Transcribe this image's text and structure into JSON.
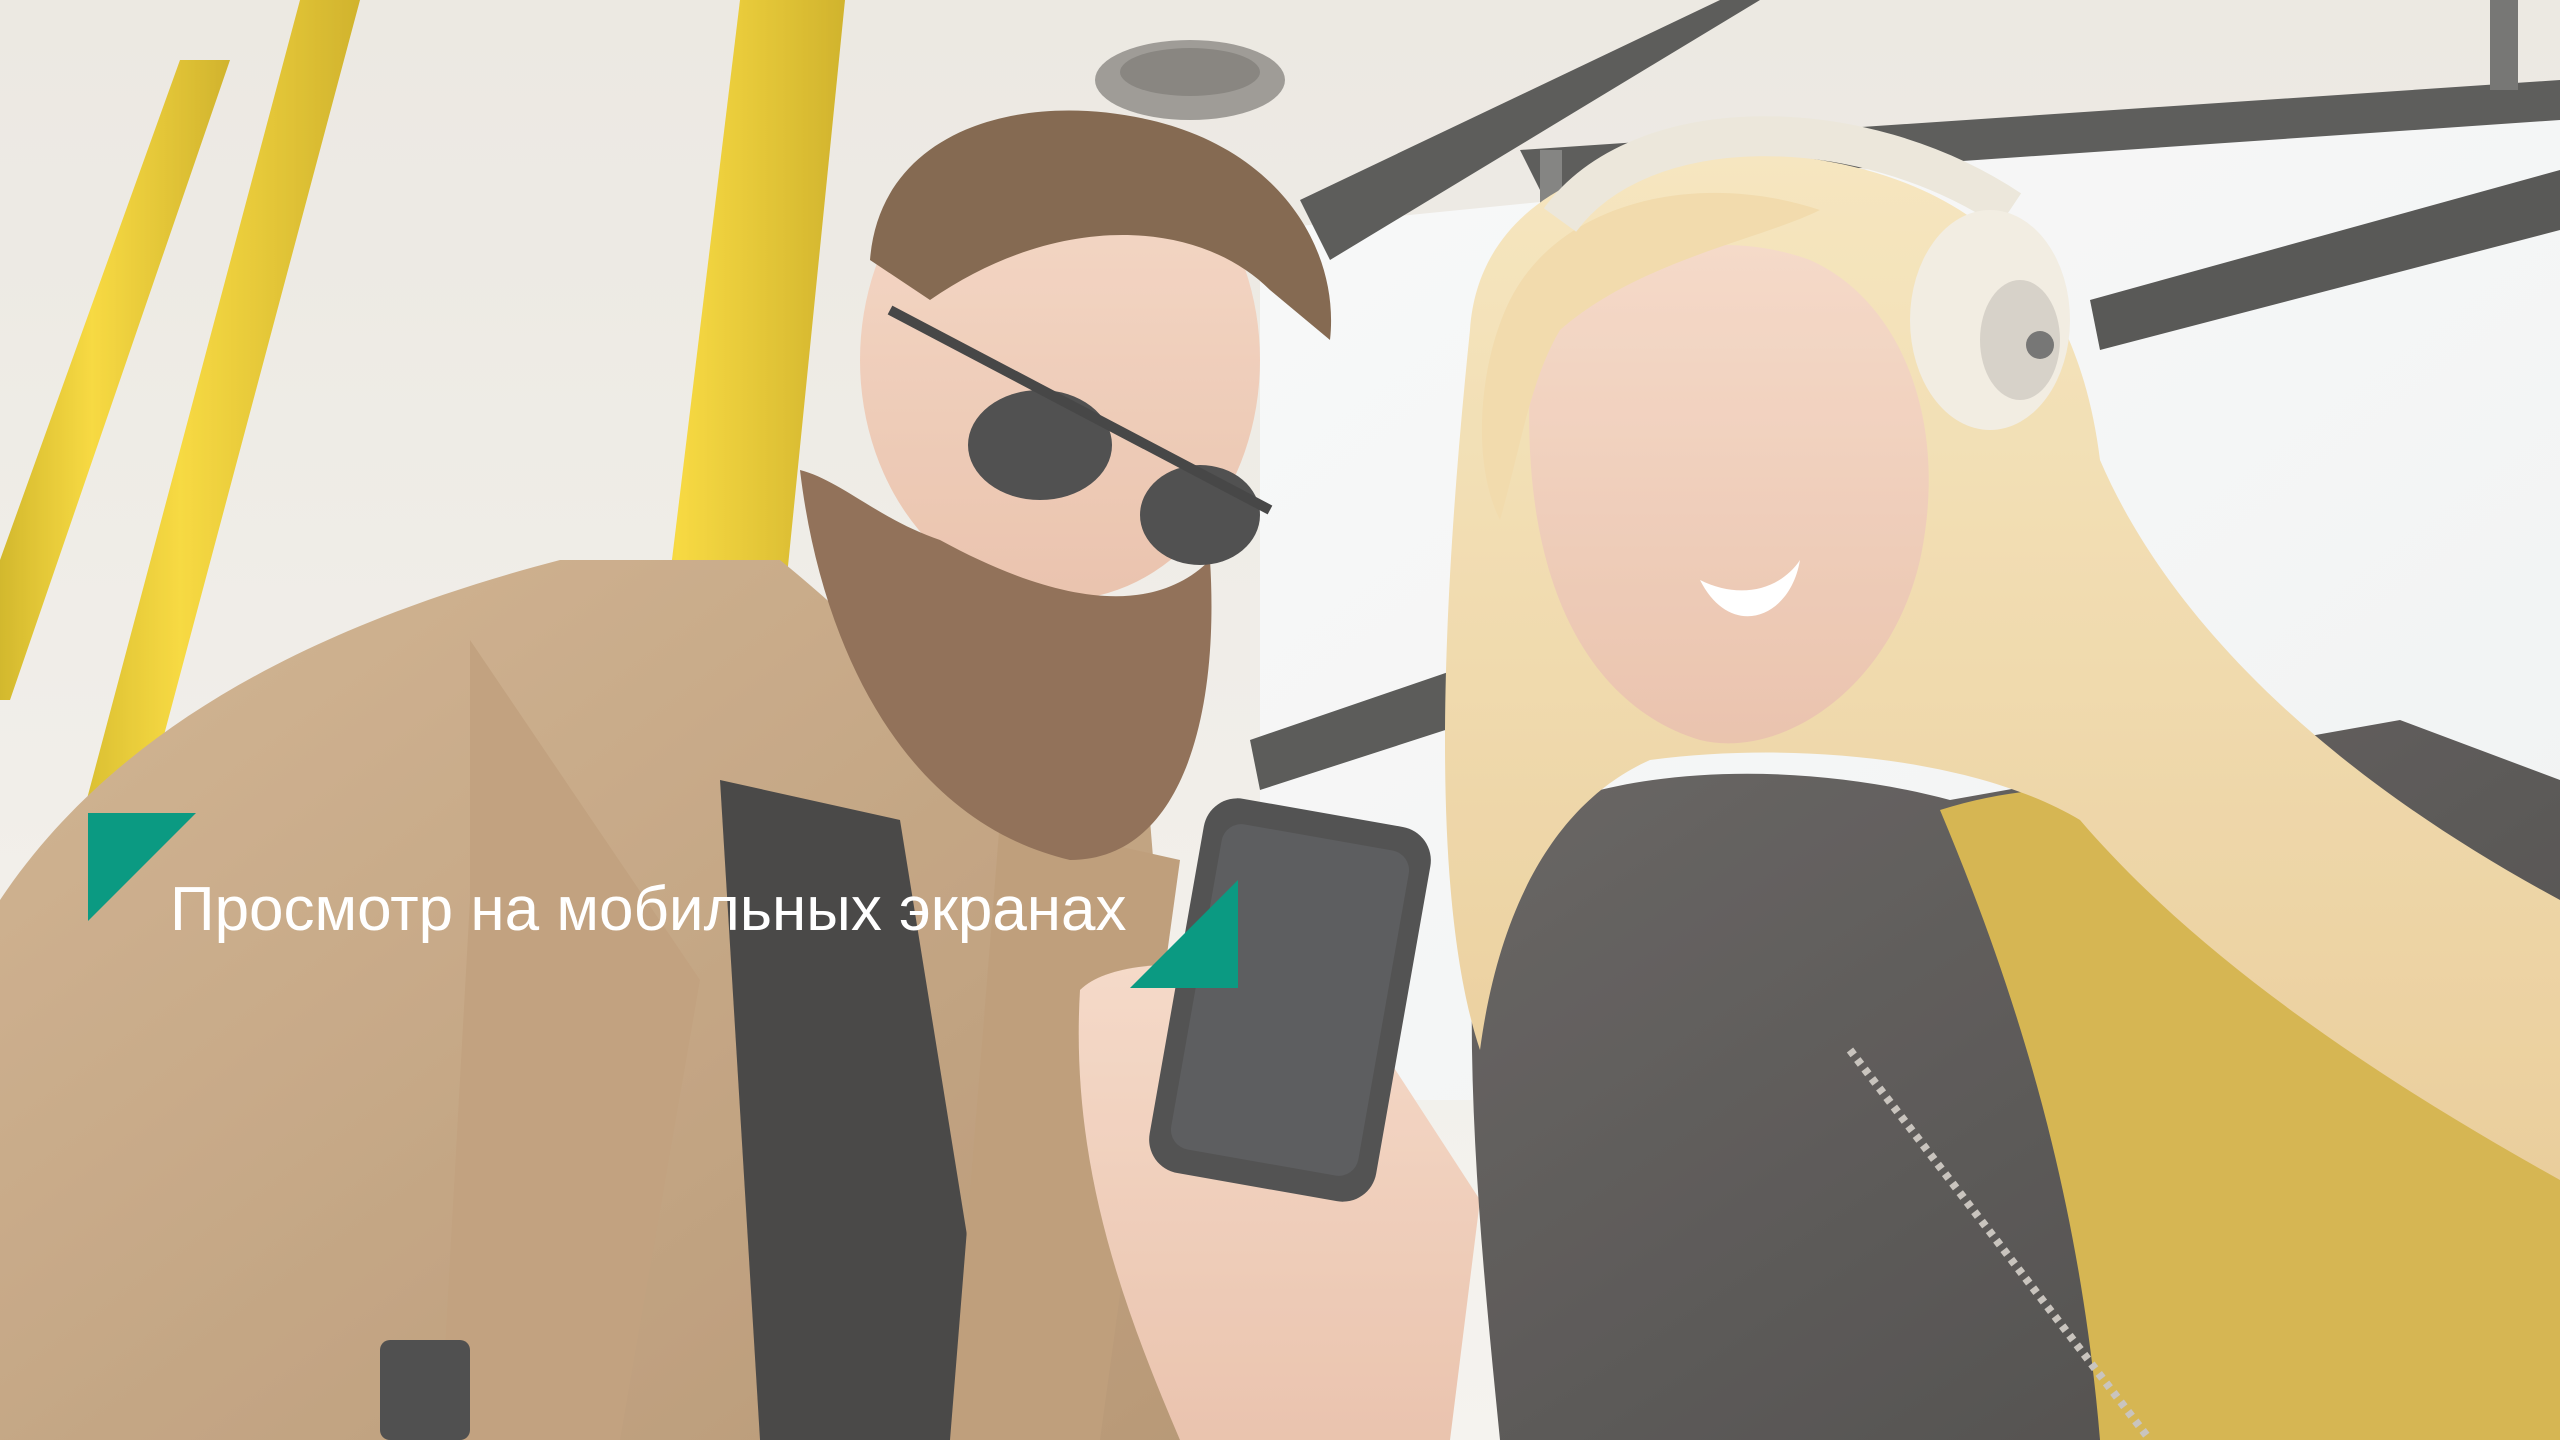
{
  "slide": {
    "caption": "Просмотр на мобильных экранах",
    "accent_color": "#0b9a82",
    "caption_color": "#ffffff",
    "photo": {
      "subject": "photo-bus-passengers-phone"
    }
  }
}
